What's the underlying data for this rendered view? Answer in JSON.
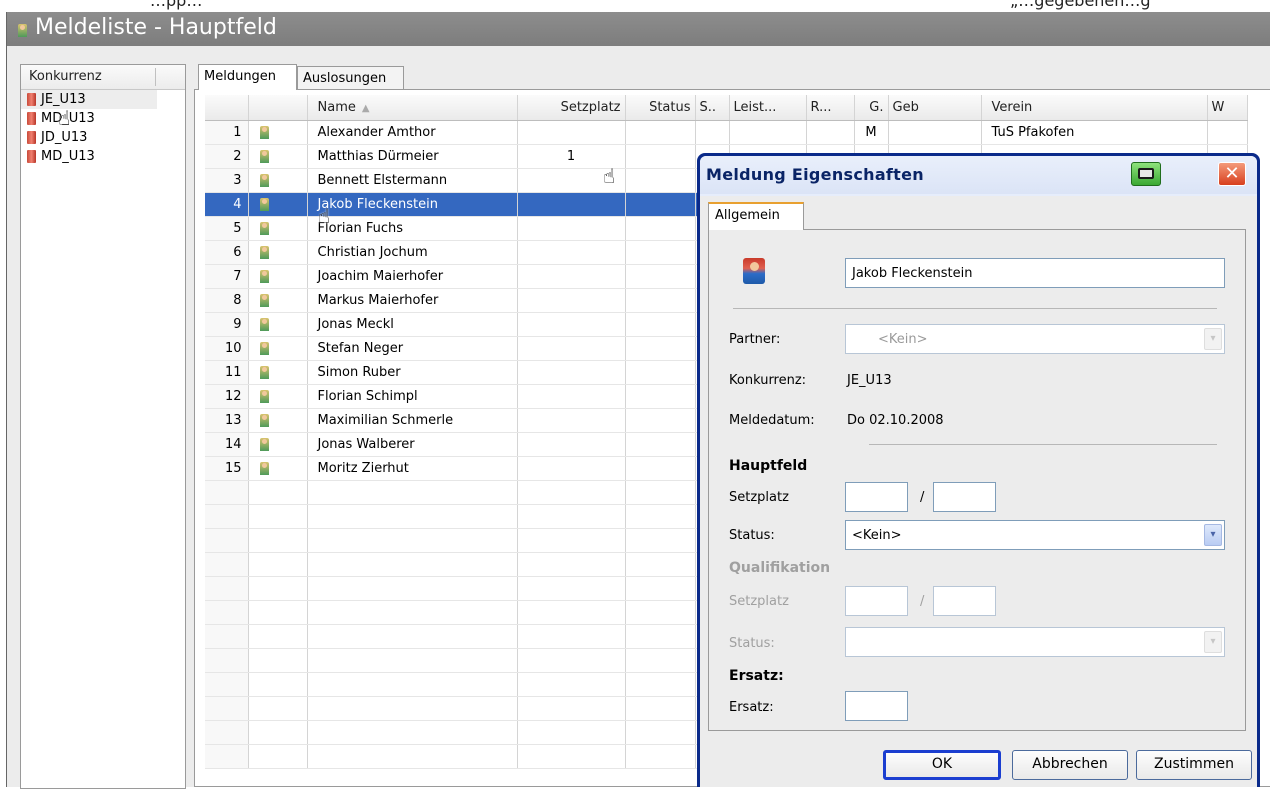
{
  "top_strip": {
    "text_left": "…pp…",
    "text_right": "„…gegebenen…g"
  },
  "window": {
    "title": "Meldeliste - Hauptfeld"
  },
  "left_panel": {
    "header": "Konkurrenz",
    "items": [
      {
        "label": "JE_U13",
        "selected": true
      },
      {
        "label": "MD_U13"
      },
      {
        "label": "JD_U13"
      },
      {
        "label": "MD_U13"
      }
    ]
  },
  "tabs": [
    {
      "label": "Meldungen",
      "active": true
    },
    {
      "label": "Auslosungen"
    }
  ],
  "grid": {
    "columns": [
      "",
      "",
      "Name",
      "Setzplatz",
      "Status",
      "S..",
      "Leist...",
      "R...",
      "G.",
      "Geb",
      "Verein",
      "W"
    ],
    "sort_indicator": "▲",
    "rows": [
      {
        "num": "1",
        "name": "Alexander Amthor",
        "setzplatz": "",
        "g": "M",
        "verein": "TuS Pfakofen"
      },
      {
        "num": "2",
        "name": "Matthias Dürmeier",
        "setzplatz": "1",
        "g": "",
        "verein": ""
      },
      {
        "num": "3",
        "name": "Bennett Elstermann",
        "setzplatz": "",
        "g": "",
        "verein": ""
      },
      {
        "num": "4",
        "name": "Jakob Fleckenstein",
        "setzplatz": "",
        "g": "",
        "verein": ""
      },
      {
        "num": "5",
        "name": "Florian Fuchs",
        "setzplatz": "",
        "g": "",
        "verein": ""
      },
      {
        "num": "6",
        "name": "Christian Jochum",
        "setzplatz": "",
        "g": "",
        "verein": ""
      },
      {
        "num": "7",
        "name": "Joachim Maierhofer",
        "setzplatz": "",
        "g": "",
        "verein": ""
      },
      {
        "num": "8",
        "name": "Markus Maierhofer",
        "setzplatz": "",
        "g": "",
        "verein": ""
      },
      {
        "num": "9",
        "name": "Jonas Meckl",
        "setzplatz": "",
        "g": "",
        "verein": ""
      },
      {
        "num": "10",
        "name": "Stefan Neger",
        "setzplatz": "",
        "g": "",
        "verein": ""
      },
      {
        "num": "11",
        "name": "Simon Ruber",
        "setzplatz": "",
        "g": "",
        "verein": ""
      },
      {
        "num": "12",
        "name": "Florian Schimpl",
        "setzplatz": "",
        "g": "",
        "verein": ""
      },
      {
        "num": "13",
        "name": "Maximilian Schmerle",
        "setzplatz": "",
        "g": "",
        "verein": ""
      },
      {
        "num": "14",
        "name": "Jonas Walberer",
        "setzplatz": "",
        "g": "",
        "verein": ""
      },
      {
        "num": "15",
        "name": "Moritz Zierhut",
        "setzplatz": "",
        "g": "",
        "verein": ""
      }
    ],
    "selected_row": 4
  },
  "dialog": {
    "title": "Meldung Eigenschaften",
    "tab": "Allgemein",
    "name_value": "Jakob Fleckenstein",
    "partner_label": "Partner:",
    "partner_value": "<Kein>",
    "konkurrenz_label": "Konkurrenz:",
    "konkurrenz_value": "JE_U13",
    "meldedatum_label": "Meldedatum:",
    "meldedatum_value": "Do 02.10.2008",
    "hauptfeld_heading": "Hauptfeld",
    "setzplatz_label": "Setzplatz",
    "slash": "/",
    "status_label": "Status:",
    "status_value": "<Kein>",
    "qualifikation_heading": "Qualifikation",
    "q_setzplatz_label": "Setzplatz",
    "q_status_label": "Status:",
    "ersatz_heading": "Ersatz:",
    "ersatz_label": "Ersatz:",
    "buttons": {
      "ok": "OK",
      "cancel": "Abbrechen",
      "apply": "Zustimmen"
    }
  },
  "icons": {
    "close": "✕",
    "dropdown": "▾",
    "cursor": "☝"
  }
}
